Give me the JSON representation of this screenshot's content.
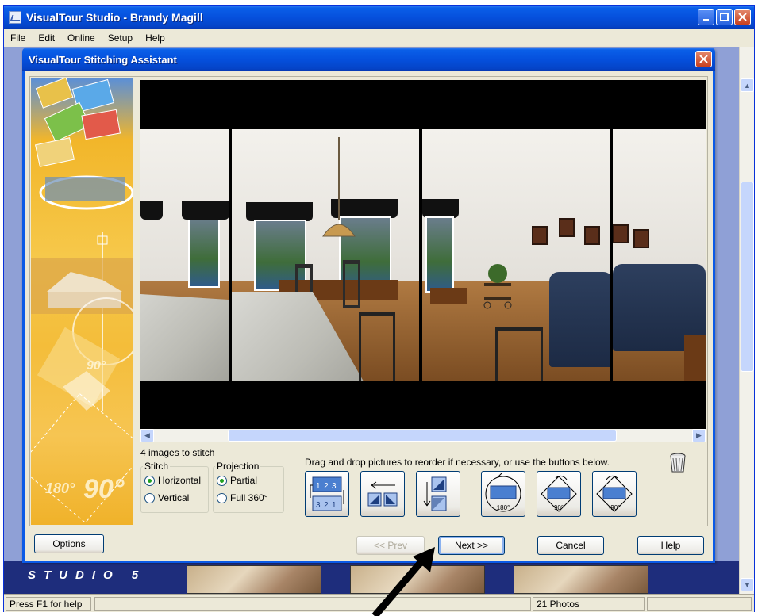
{
  "app": {
    "title": "VisualTour Studio - Brandy Magill",
    "menu": [
      "File",
      "Edit",
      "Online",
      "Setup",
      "Help"
    ],
    "window_buttons": [
      "minimize",
      "maximize",
      "close"
    ],
    "studio_logo": "STUDIO 5"
  },
  "statusbar": {
    "help_text": "Press F1 for help",
    "photo_count": "21 Photos"
  },
  "dialog": {
    "title": "VisualTour Stitching Assistant",
    "banner_degrees": [
      "90°",
      "180°",
      "90°"
    ],
    "images_count_label": "4 images to stitch",
    "instructions": "Drag and drop pictures to reorder if necessary, or use the buttons below.",
    "stitch": {
      "legend": "Stitch",
      "options": [
        "Horizontal",
        "Vertical"
      ],
      "selected": "Horizontal"
    },
    "projection": {
      "legend": "Projection",
      "options": [
        "Partial",
        "Full 360°"
      ],
      "selected": "Partial"
    },
    "tools": [
      {
        "icon": "reverse-order-icon",
        "label": ""
      },
      {
        "icon": "swap-left-icon",
        "label": ""
      },
      {
        "icon": "flip-vertical-icon",
        "label": ""
      },
      {
        "icon": "rotate-180-icon",
        "label": "180°"
      },
      {
        "icon": "rotate-90-cw-icon",
        "label": "90°"
      },
      {
        "icon": "rotate-90-ccw-icon",
        "label": "-90°"
      }
    ],
    "tool_numbers": {
      "top": [
        "1",
        "2",
        "3"
      ],
      "bottom": [
        "3",
        "2",
        "1"
      ]
    },
    "buttons": {
      "options": "Options",
      "prev": "<< Prev",
      "next": "Next >>",
      "cancel": "Cancel",
      "help": "Help"
    },
    "prev_enabled": false,
    "focused_button": "next"
  },
  "colors": {
    "title_blue": "#0550dd",
    "dialog_face": "#ece9d8",
    "banner_gold": "#f4bd3a",
    "scroll_thumb": "#c5d6fc"
  }
}
